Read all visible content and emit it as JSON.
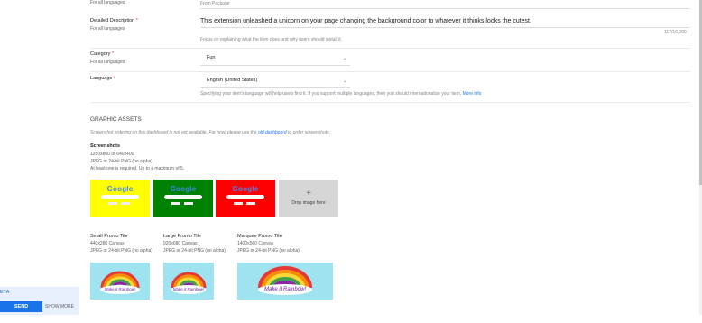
{
  "package_field": {
    "sub": "For all languages",
    "placeholder": "From Package"
  },
  "detailed_description": {
    "label": "Detailed Description",
    "required": "*",
    "sub": "For all languages",
    "value": "This extension unleashed a unicorn on your page changing the background color to whatever it thinks looks the cutest.",
    "counter": "117/16,000",
    "hint": "Focus on explaining what the item does and why users should install it."
  },
  "category": {
    "label": "Category",
    "required": "*",
    "sub": "For all languages",
    "value": "Fun"
  },
  "language": {
    "label": "Language",
    "required": "*",
    "value": "English (United States)",
    "hint": "Specifying your item's language will help users find it. If you support multiple languages, then you should internationalize your item.",
    "link": "More info"
  },
  "graphic_assets": {
    "heading": "GRAPHIC ASSETS",
    "notice_pre": "Screenshot ordering on this dashboard is not yet available. For now, please use the",
    "notice_link": "old dashboard",
    "notice_post": "to order screenshots."
  },
  "screenshots": {
    "label": "Screenshots",
    "size": "1280x800 or 640x400",
    "format": "JPEG or 24-bit PNG (no alpha)",
    "rule": "At least one is required. Up to a maximum of 5.",
    "logo_text": "Google",
    "colors": [
      "#ffff00",
      "#008000",
      "#ff0000"
    ],
    "drop_icon": "+",
    "drop_label": "Drop image here"
  },
  "promo_tiles": [
    {
      "label": "Small Promo Tile",
      "size": "440x280 Canvas",
      "format": "JPEG or 24-bit PNG (no alpha)",
      "caption": "Make it Rainbow!"
    },
    {
      "label": "Large Promo Tile",
      "size": "920x680 Canvas",
      "format": "JPEG or 24-bit PNG (no alpha)",
      "caption": "Make it Rainbow!"
    },
    {
      "label": "Marquee Promo Tile",
      "size": "1400x560 Canvas",
      "format": "JPEG or 24-bit PNG (no alpha)",
      "caption": "Make it Rainbow!"
    }
  ],
  "feedback": {
    "beta": "ETA",
    "send": "SEND FEEDBACK",
    "show_more": "SHOW MORE"
  },
  "icons": {
    "chevron": "chevron-down-icon",
    "plus": "plus-icon"
  }
}
